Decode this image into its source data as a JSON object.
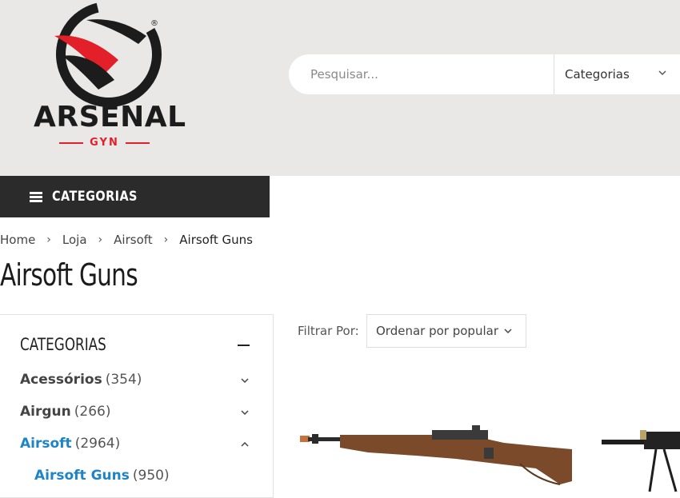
{
  "header": {
    "logo": {
      "name": "ARSENAL",
      "sub": "GYN",
      "mark": "®"
    },
    "search": {
      "placeholder": "Pesquisar...",
      "category_label": "Categorias"
    }
  },
  "category_bar": {
    "label": "CATEGORIAS",
    "icon": "menu-icon"
  },
  "breadcrumb": [
    {
      "label": "Home"
    },
    {
      "label": "Loja"
    },
    {
      "label": "Airsoft"
    },
    {
      "label": "Airsoft Guns"
    }
  ],
  "page_title": "Airsoft Guns",
  "sidebar": {
    "title": "CATEGORIAS",
    "items": [
      {
        "label": "Acessórios",
        "count": "(354)",
        "chevron": "chevron-down-icon"
      },
      {
        "label": "Airgun",
        "count": "(266)",
        "chevron": "chevron-down-icon"
      },
      {
        "label": "Airsoft",
        "count": "(2964)",
        "chevron": "chevron-up-icon"
      },
      {
        "label": "Airsoft Guns",
        "count": "(950)"
      }
    ]
  },
  "filter": {
    "label": "Filtrar Por:",
    "sort_value": "Ordenar por popular"
  },
  "colors": {
    "accent_blue": "#1e84c8",
    "brand_red": "#e3202a",
    "dark_bar": "#2b2b2b",
    "header_bg": "#e9e8e7"
  }
}
